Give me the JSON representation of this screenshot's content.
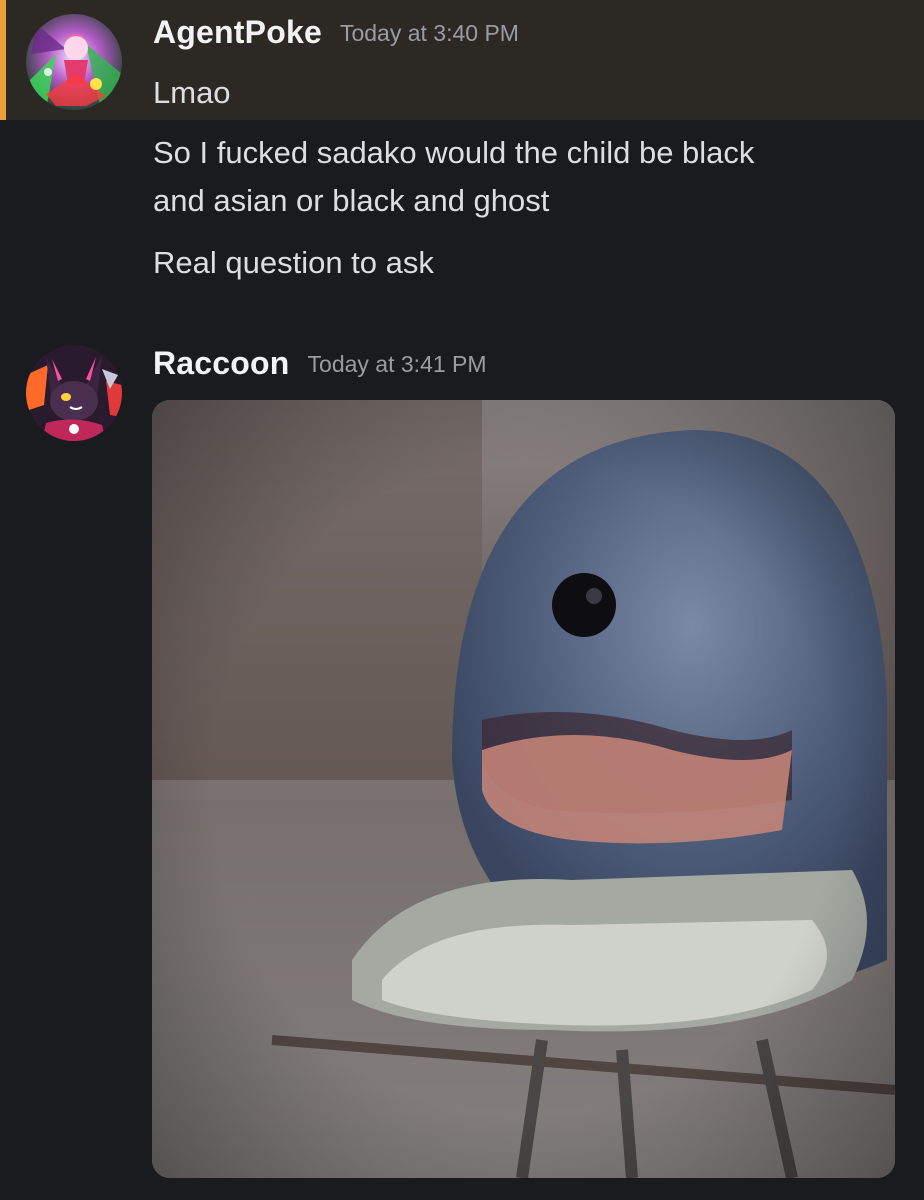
{
  "messages": [
    {
      "username": "AgentPoke",
      "timestamp": "Today at 3:40 PM",
      "highlighted": true,
      "highlight_color": "#e7a23b",
      "avatar_icon": "anime-avatar-icon",
      "lines": [
        "Lmao",
        "So I fucked sadako would the child be black",
        "and asian or black and ghost",
        "Real question to ask"
      ]
    },
    {
      "username": "Raccoon",
      "timestamp": "Today at 3:41 PM",
      "highlighted": false,
      "avatar_icon": "cartoon-creature-avatar-icon",
      "attachment": {
        "type": "image",
        "icon": "blue-plush-on-tray-photo"
      }
    }
  ],
  "colors": {
    "background": "#1a1b1f",
    "highlight_background": "#2c2925",
    "username": "#f2f3f5",
    "timestamp": "#9a9ca3",
    "message_text": "#dcdee2"
  }
}
